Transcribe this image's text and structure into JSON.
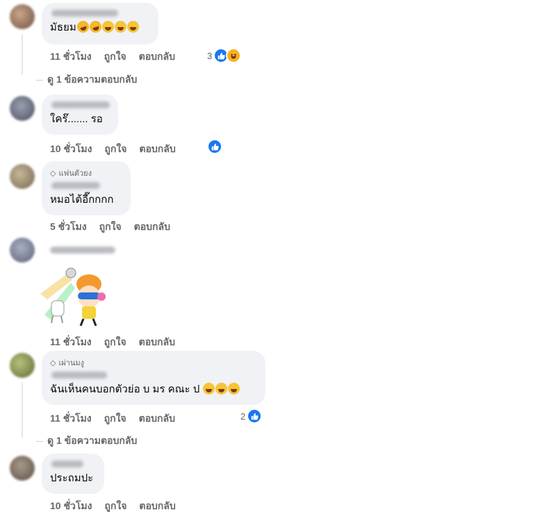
{
  "comments": [
    {
      "text": "มัธยม",
      "time": "11 ชั่วโมง",
      "like": "ถูกใจ",
      "reply": "ตอบกลับ",
      "reaction_count": "3",
      "reactions": [
        "like-icon",
        "haha-icon"
      ],
      "emojis": [
        "rolling-laughing-emoji",
        "rolling-laughing-emoji",
        "grinning-emoji",
        "grinning-emoji",
        "grinning-emoji"
      ],
      "replies_link": "ดู 1 ข้อความตอบกลับ"
    },
    {
      "text": "ใคร๊....... รอ",
      "time": "10 ชั่วโมง",
      "like": "ถูกใจ",
      "reply": "ตอบกลับ",
      "reactions": [
        "like-icon"
      ]
    },
    {
      "badge": "แฟนตัวยง",
      "text": "หมอไต้อี๊กกกก",
      "time": "5 ชั่วโมง",
      "like": "ถูกใจ",
      "reply": "ตอบกลับ"
    },
    {
      "sticker": "dancing-girl-sticker",
      "time": "11 ชั่วโมง",
      "like": "ถูกใจ",
      "reply": "ตอบกลับ"
    },
    {
      "badge": "เผ่านมงู",
      "text": "ฉันเห็นคนบอกตัวย่อ บ มร คณะ ป",
      "emojis": [
        "laughing-emoji",
        "laughing-emoji",
        "laughing-emoji"
      ],
      "time": "11 ชั่วโมง",
      "like": "ถูกใจ",
      "reply": "ตอบกลับ",
      "reaction_count": "2",
      "reactions": [
        "like-icon"
      ],
      "replies_link": "ดู 1 ข้อความตอบกลับ"
    },
    {
      "text": "ประถมปะ",
      "time": "10 ชั่วโมง",
      "like": "ถูกใจ",
      "reply": "ตอบกลับ"
    }
  ],
  "colors": {
    "bubble": "#f0f2f5",
    "meta_text": "#65676b",
    "like_blue": "#1877f2",
    "haha_yellow": "#f7b125"
  }
}
